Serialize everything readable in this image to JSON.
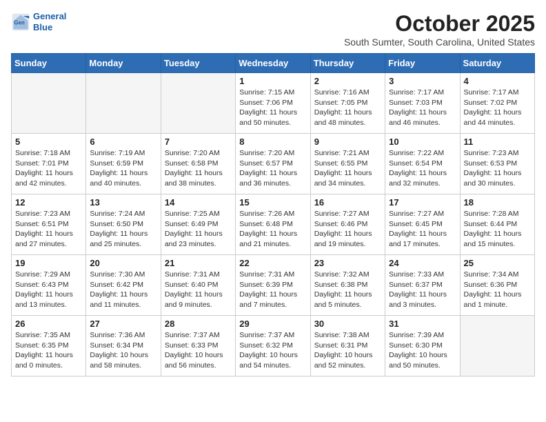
{
  "header": {
    "logo_line1": "General",
    "logo_line2": "Blue",
    "title": "October 2025",
    "subtitle": "South Sumter, South Carolina, United States"
  },
  "calendar": {
    "headers": [
      "Sunday",
      "Monday",
      "Tuesday",
      "Wednesday",
      "Thursday",
      "Friday",
      "Saturday"
    ],
    "weeks": [
      [
        {
          "day": "",
          "info": ""
        },
        {
          "day": "",
          "info": ""
        },
        {
          "day": "",
          "info": ""
        },
        {
          "day": "1",
          "info": "Sunrise: 7:15 AM\nSunset: 7:06 PM\nDaylight: 11 hours\nand 50 minutes."
        },
        {
          "day": "2",
          "info": "Sunrise: 7:16 AM\nSunset: 7:05 PM\nDaylight: 11 hours\nand 48 minutes."
        },
        {
          "day": "3",
          "info": "Sunrise: 7:17 AM\nSunset: 7:03 PM\nDaylight: 11 hours\nand 46 minutes."
        },
        {
          "day": "4",
          "info": "Sunrise: 7:17 AM\nSunset: 7:02 PM\nDaylight: 11 hours\nand 44 minutes."
        }
      ],
      [
        {
          "day": "5",
          "info": "Sunrise: 7:18 AM\nSunset: 7:01 PM\nDaylight: 11 hours\nand 42 minutes."
        },
        {
          "day": "6",
          "info": "Sunrise: 7:19 AM\nSunset: 6:59 PM\nDaylight: 11 hours\nand 40 minutes."
        },
        {
          "day": "7",
          "info": "Sunrise: 7:20 AM\nSunset: 6:58 PM\nDaylight: 11 hours\nand 38 minutes."
        },
        {
          "day": "8",
          "info": "Sunrise: 7:20 AM\nSunset: 6:57 PM\nDaylight: 11 hours\nand 36 minutes."
        },
        {
          "day": "9",
          "info": "Sunrise: 7:21 AM\nSunset: 6:55 PM\nDaylight: 11 hours\nand 34 minutes."
        },
        {
          "day": "10",
          "info": "Sunrise: 7:22 AM\nSunset: 6:54 PM\nDaylight: 11 hours\nand 32 minutes."
        },
        {
          "day": "11",
          "info": "Sunrise: 7:23 AM\nSunset: 6:53 PM\nDaylight: 11 hours\nand 30 minutes."
        }
      ],
      [
        {
          "day": "12",
          "info": "Sunrise: 7:23 AM\nSunset: 6:51 PM\nDaylight: 11 hours\nand 27 minutes."
        },
        {
          "day": "13",
          "info": "Sunrise: 7:24 AM\nSunset: 6:50 PM\nDaylight: 11 hours\nand 25 minutes."
        },
        {
          "day": "14",
          "info": "Sunrise: 7:25 AM\nSunset: 6:49 PM\nDaylight: 11 hours\nand 23 minutes."
        },
        {
          "day": "15",
          "info": "Sunrise: 7:26 AM\nSunset: 6:48 PM\nDaylight: 11 hours\nand 21 minutes."
        },
        {
          "day": "16",
          "info": "Sunrise: 7:27 AM\nSunset: 6:46 PM\nDaylight: 11 hours\nand 19 minutes."
        },
        {
          "day": "17",
          "info": "Sunrise: 7:27 AM\nSunset: 6:45 PM\nDaylight: 11 hours\nand 17 minutes."
        },
        {
          "day": "18",
          "info": "Sunrise: 7:28 AM\nSunset: 6:44 PM\nDaylight: 11 hours\nand 15 minutes."
        }
      ],
      [
        {
          "day": "19",
          "info": "Sunrise: 7:29 AM\nSunset: 6:43 PM\nDaylight: 11 hours\nand 13 minutes."
        },
        {
          "day": "20",
          "info": "Sunrise: 7:30 AM\nSunset: 6:42 PM\nDaylight: 11 hours\nand 11 minutes."
        },
        {
          "day": "21",
          "info": "Sunrise: 7:31 AM\nSunset: 6:40 PM\nDaylight: 11 hours\nand 9 minutes."
        },
        {
          "day": "22",
          "info": "Sunrise: 7:31 AM\nSunset: 6:39 PM\nDaylight: 11 hours\nand 7 minutes."
        },
        {
          "day": "23",
          "info": "Sunrise: 7:32 AM\nSunset: 6:38 PM\nDaylight: 11 hours\nand 5 minutes."
        },
        {
          "day": "24",
          "info": "Sunrise: 7:33 AM\nSunset: 6:37 PM\nDaylight: 11 hours\nand 3 minutes."
        },
        {
          "day": "25",
          "info": "Sunrise: 7:34 AM\nSunset: 6:36 PM\nDaylight: 11 hours\nand 1 minute."
        }
      ],
      [
        {
          "day": "26",
          "info": "Sunrise: 7:35 AM\nSunset: 6:35 PM\nDaylight: 11 hours\nand 0 minutes."
        },
        {
          "day": "27",
          "info": "Sunrise: 7:36 AM\nSunset: 6:34 PM\nDaylight: 10 hours\nand 58 minutes."
        },
        {
          "day": "28",
          "info": "Sunrise: 7:37 AM\nSunset: 6:33 PM\nDaylight: 10 hours\nand 56 minutes."
        },
        {
          "day": "29",
          "info": "Sunrise: 7:37 AM\nSunset: 6:32 PM\nDaylight: 10 hours\nand 54 minutes."
        },
        {
          "day": "30",
          "info": "Sunrise: 7:38 AM\nSunset: 6:31 PM\nDaylight: 10 hours\nand 52 minutes."
        },
        {
          "day": "31",
          "info": "Sunrise: 7:39 AM\nSunset: 6:30 PM\nDaylight: 10 hours\nand 50 minutes."
        },
        {
          "day": "",
          "info": ""
        }
      ]
    ]
  }
}
